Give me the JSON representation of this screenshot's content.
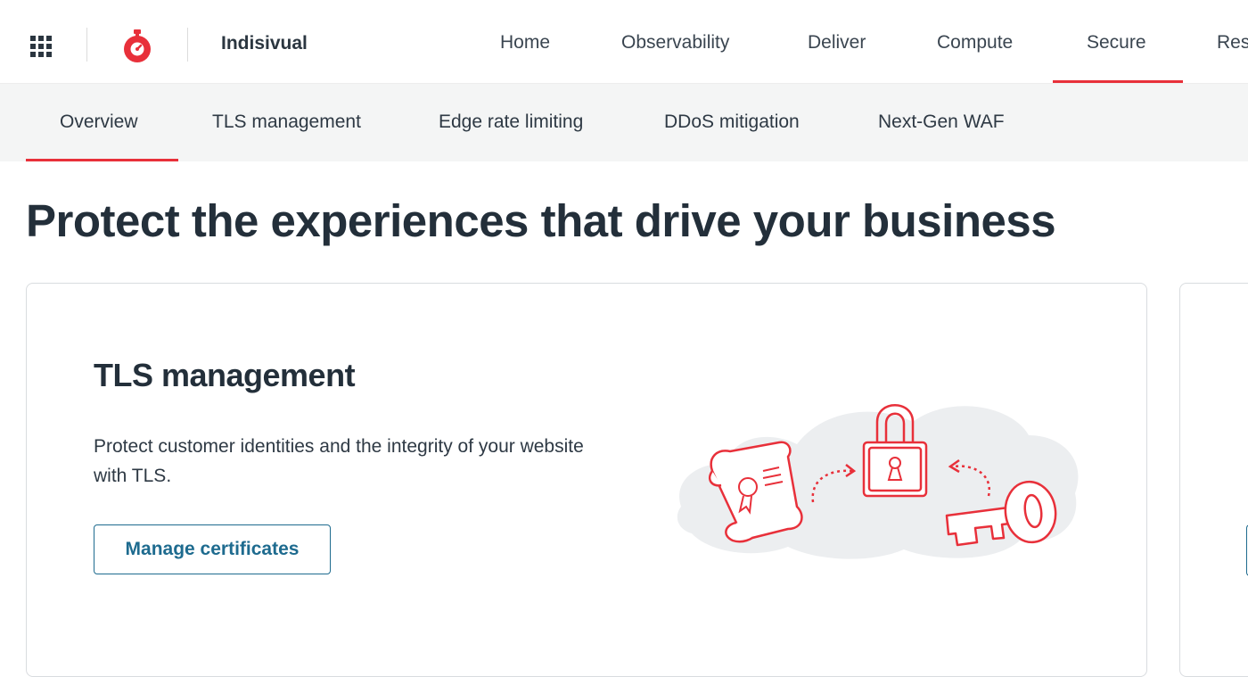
{
  "brand": {
    "name": "Indisivual",
    "accent": "#e8303a"
  },
  "topnav": {
    "items": [
      {
        "label": "Home"
      },
      {
        "label": "Observability"
      },
      {
        "label": "Deliver"
      },
      {
        "label": "Compute"
      },
      {
        "label": "Secure",
        "active": true
      },
      {
        "label": "Res"
      }
    ]
  },
  "subnav": {
    "items": [
      {
        "label": "Overview",
        "active": true
      },
      {
        "label": "TLS management"
      },
      {
        "label": "Edge rate limiting"
      },
      {
        "label": "DDoS mitigation"
      },
      {
        "label": "Next-Gen WAF"
      }
    ]
  },
  "main": {
    "title": "Protect the experiences that drive your business",
    "card": {
      "title": "TLS management",
      "description": "Protect customer identities and the integrity of your website with TLS.",
      "button_label": "Manage certificates",
      "illustration": "certificate-lock-key-illustration"
    }
  },
  "colors": {
    "button": "#1e6b8f",
    "text": "#232f3a",
    "subnav_bg": "#f4f5f5"
  }
}
